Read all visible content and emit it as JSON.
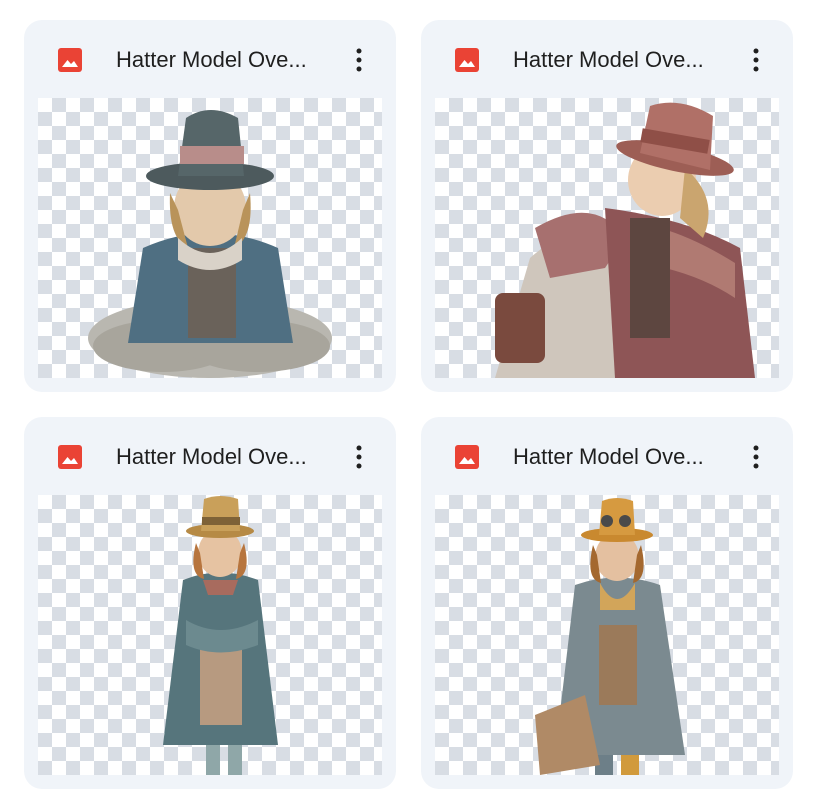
{
  "colors": {
    "card_background": "#f0f4f9",
    "image_icon_red": "#ea4335",
    "title_text": "#1f1f1f",
    "checker_light": "#ffffff",
    "checker_dark": "#d8dde4"
  },
  "files": [
    {
      "title": "Hatter Model Ove...",
      "file_icon": "image-file-icon",
      "menu_icon": "more-vert-icon",
      "thumbnail": "hatter-boy-sitting-crosslegged-chin-in-hands"
    },
    {
      "title": "Hatter Model Ove...",
      "file_icon": "image-file-icon",
      "menu_icon": "more-vert-icon",
      "thumbnail": "hatter-boy-sitting-looking-aside"
    },
    {
      "title": "Hatter Model Ove...",
      "file_icon": "image-file-icon",
      "menu_icon": "more-vert-icon",
      "thumbnail": "hatter-boy-standing-arms-crossed"
    },
    {
      "title": "Hatter Model Ove...",
      "file_icon": "image-file-icon",
      "menu_icon": "more-vert-icon",
      "thumbnail": "hatter-boy-standing-with-goggles-hat"
    }
  ]
}
